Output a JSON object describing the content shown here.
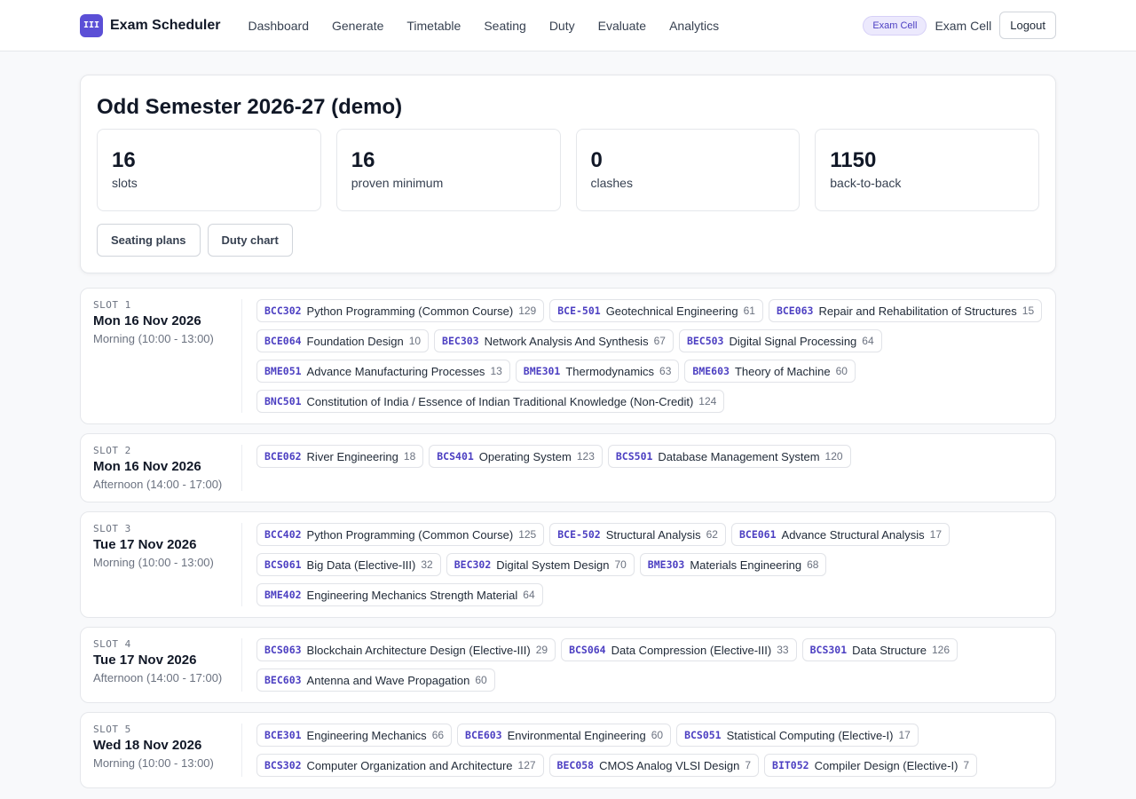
{
  "app": {
    "logo_text": "III",
    "name": "Exam Scheduler"
  },
  "nav": [
    "Dashboard",
    "Generate",
    "Timetable",
    "Seating",
    "Duty",
    "Evaluate",
    "Analytics"
  ],
  "user": {
    "role_badge": "Exam Cell",
    "name": "Exam Cell",
    "logout_label": "Logout"
  },
  "summary": {
    "title": "Odd Semester 2026-27 (demo)",
    "stats": [
      {
        "value": "16",
        "label": "slots"
      },
      {
        "value": "16",
        "label": "proven minimum"
      },
      {
        "value": "0",
        "label": "clashes"
      },
      {
        "value": "1150",
        "label": "back-to-back"
      }
    ],
    "actions": [
      "Seating plans",
      "Duty chart"
    ]
  },
  "slots": [
    {
      "label": "SLOT 1",
      "date": "Mon 16 Nov 2026",
      "time": "Morning (10:00 - 13:00)",
      "courses": [
        {
          "code": "BCC302",
          "name": "Python Programming (Common Course)",
          "count": "129"
        },
        {
          "code": "BCE-501",
          "name": "Geotechnical Engineering",
          "count": "61"
        },
        {
          "code": "BCE063",
          "name": "Repair and Rehabilitation of Structures",
          "count": "15"
        },
        {
          "code": "BCE064",
          "name": "Foundation Design",
          "count": "10"
        },
        {
          "code": "BEC303",
          "name": "Network Analysis And Synthesis",
          "count": "67"
        },
        {
          "code": "BEC503",
          "name": "Digital Signal Processing",
          "count": "64"
        },
        {
          "code": "BME051",
          "name": "Advance Manufacturing Processes",
          "count": "13"
        },
        {
          "code": "BME301",
          "name": "Thermodynamics",
          "count": "63"
        },
        {
          "code": "BME603",
          "name": "Theory of Machine",
          "count": "60"
        },
        {
          "code": "BNC501",
          "name": "Constitution of India / Essence of Indian Traditional Knowledge (Non-Credit)",
          "count": "124"
        }
      ]
    },
    {
      "label": "SLOT 2",
      "date": "Mon 16 Nov 2026",
      "time": "Afternoon (14:00 - 17:00)",
      "courses": [
        {
          "code": "BCE062",
          "name": "River Engineering",
          "count": "18"
        },
        {
          "code": "BCS401",
          "name": "Operating System",
          "count": "123"
        },
        {
          "code": "BCS501",
          "name": "Database Management System",
          "count": "120"
        }
      ]
    },
    {
      "label": "SLOT 3",
      "date": "Tue 17 Nov 2026",
      "time": "Morning (10:00 - 13:00)",
      "courses": [
        {
          "code": "BCC402",
          "name": "Python Programming (Common Course)",
          "count": "125"
        },
        {
          "code": "BCE-502",
          "name": "Structural Analysis",
          "count": "62"
        },
        {
          "code": "BCE061",
          "name": "Advance Structural Analysis",
          "count": "17"
        },
        {
          "code": "BCS061",
          "name": "Big Data (Elective-III)",
          "count": "32"
        },
        {
          "code": "BEC302",
          "name": "Digital System Design",
          "count": "70"
        },
        {
          "code": "BME303",
          "name": "Materials Engineering",
          "count": "68"
        },
        {
          "code": "BME402",
          "name": "Engineering Mechanics Strength Material",
          "count": "64"
        }
      ]
    },
    {
      "label": "SLOT 4",
      "date": "Tue 17 Nov 2026",
      "time": "Afternoon (14:00 - 17:00)",
      "courses": [
        {
          "code": "BCS063",
          "name": "Blockchain Architecture Design (Elective-III)",
          "count": "29"
        },
        {
          "code": "BCS064",
          "name": "Data Compression (Elective-III)",
          "count": "33"
        },
        {
          "code": "BCS301",
          "name": "Data Structure",
          "count": "126"
        },
        {
          "code": "BEC603",
          "name": "Antenna and Wave Propagation",
          "count": "60"
        }
      ]
    },
    {
      "label": "SLOT 5",
      "date": "Wed 18 Nov 2026",
      "time": "Morning (10:00 - 13:00)",
      "courses": [
        {
          "code": "BCE301",
          "name": "Engineering Mechanics",
          "count": "66"
        },
        {
          "code": "BCE603",
          "name": "Environmental Engineering",
          "count": "60"
        },
        {
          "code": "BCS051",
          "name": "Statistical Computing (Elective-I)",
          "count": "17"
        },
        {
          "code": "BCS302",
          "name": "Computer Organization and Architecture",
          "count": "127"
        },
        {
          "code": "BEC058",
          "name": "CMOS Analog VLSI Design",
          "count": "7"
        },
        {
          "code": "BIT052",
          "name": "Compiler Design (Elective-I)",
          "count": "7"
        }
      ]
    }
  ]
}
